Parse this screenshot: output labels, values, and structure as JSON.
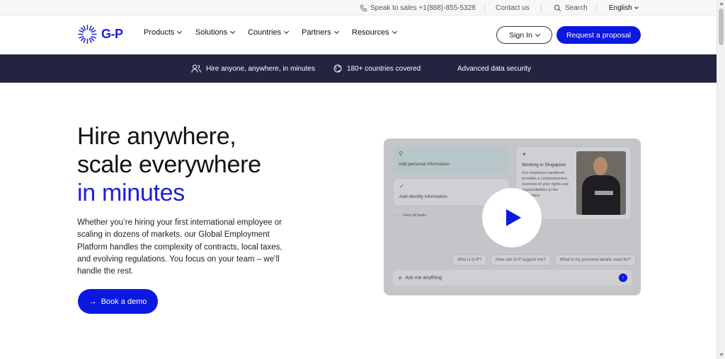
{
  "topbar": {
    "phone": "Speak to sales +1(888)-855-5328",
    "contact": "Contact us",
    "search": "Search",
    "language": "English"
  },
  "nav": {
    "logo_text": "G‑P",
    "items": [
      {
        "label": "Products"
      },
      {
        "label": "Solutions"
      },
      {
        "label": "Countries"
      },
      {
        "label": "Partners"
      },
      {
        "label": "Resources"
      }
    ],
    "sign_in": "Sign In",
    "cta": "Request a proposal"
  },
  "band": {
    "items": [
      {
        "label": "Hire anyone, anywhere, in minutes",
        "icon": "people-icon"
      },
      {
        "label": "180+ countries covered",
        "icon": "globe-icon"
      },
      {
        "label": "Advanced data security",
        "icon": ""
      }
    ]
  },
  "hero": {
    "title_line1": "Hire anywhere,",
    "title_line2": "scale everywhere",
    "title_line3": "in minutes",
    "description": "Whether you’re hiring your first international employee or scaling in dozens of markets, our Global Employment Platform handles the complexity of contracts, local taxes, and evolving regulations. You focus on your team – we’ll handle the rest.",
    "button": "Book a demo"
  },
  "video": {
    "card1": "Add personal information",
    "card2": "Add identity information",
    "view_all": "View all tasks",
    "card3_title": "Working in Singapore",
    "card3_body": "Our employee handbook provides a comprehensive overview of your rights and responsibilities in the workplace.",
    "chips": [
      "Who is G‑P?",
      "How can G‑P support me?",
      "What is my personal details used for?"
    ],
    "ask_placeholder": "Ask me anything"
  },
  "colors": {
    "accent": "#0a18e0",
    "band_bg": "#232540"
  }
}
